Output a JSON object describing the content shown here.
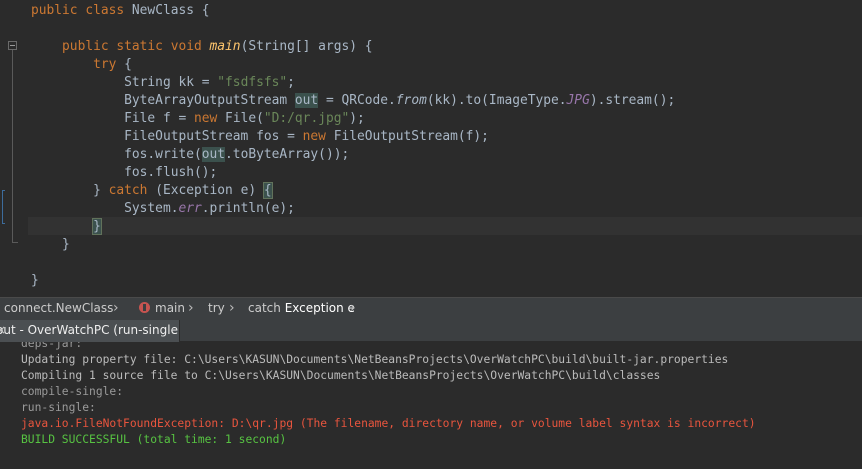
{
  "editor": {
    "class_decl": {
      "modifiers": "public class",
      "name": "NewClass",
      "brace": "{"
    },
    "method_decl": {
      "modifiers": "public static void",
      "name": "main",
      "params": "(String[] args) {"
    },
    "try_kw": "try",
    "try_brace": "{",
    "stmt1": {
      "type": "String kk = ",
      "value": "\"fsdfsfs\"",
      "end": ";"
    },
    "stmt2": {
      "start": "ByteArrayOutputStream ",
      "var": "out",
      "mid": " = QRCode.",
      "from": "from",
      "args": "(kk).to(ImageType.",
      "enum": "JPG",
      "end": ").stream();"
    },
    "stmt3": {
      "start": "File f = ",
      "new_kw": "new",
      "mid": " File(",
      "value": "\"D:/qr.jpg\"",
      "end": ");"
    },
    "stmt4": {
      "start": "FileOutputStream fos = ",
      "new_kw": "new",
      "end": " FileOutputStream(f);"
    },
    "stmt5": {
      "start": "fos.write(",
      "var": "out",
      "end": ".toByteArray());"
    },
    "stmt6": "fos.flush();",
    "catch_line": {
      "open": "} ",
      "catch_kw": "catch",
      "params": " (Exception e) ",
      "brace": "{"
    },
    "stmt7": {
      "start": "System.",
      "err": "err",
      "end": ".println(e);"
    },
    "catch_close": "}",
    "method_close": "}",
    "class_close": "}"
  },
  "breadcrumb": {
    "class": "connect.NewClass",
    "method": "main",
    "try": "try",
    "catch_prefix": "catch",
    "catch_strong": "Exception e",
    "separator": "›"
  },
  "output": {
    "tab_title": "out - OverWatchPC (run-single)",
    "close": "×",
    "lines": [
      "deps-jar:",
      "Updating property file: C:\\Users\\KASUN\\Documents\\NetBeansProjects\\OverWatchPC\\build\\built-jar.properties",
      "Compiling 1 source file to C:\\Users\\KASUN\\Documents\\NetBeansProjects\\OverWatchPC\\build\\classes",
      "compile-single:",
      "run-single:",
      "java.io.FileNotFoundException: D:\\qr.jpg (The filename, directory name, or volume label syntax is incorrect)",
      "BUILD SUCCESSFUL (total time: 1 second)"
    ]
  },
  "colors": {
    "keyword": "#cc7832",
    "string": "#6a8759",
    "error": "#e8553e",
    "success": "#57c342"
  }
}
